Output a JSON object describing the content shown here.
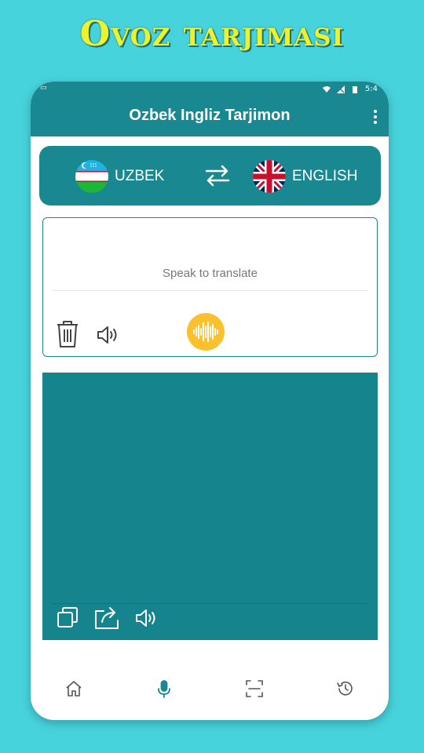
{
  "promo": {
    "title": "Ovoz tarjimasi"
  },
  "status_bar": {
    "time": "5:4"
  },
  "app_bar": {
    "title": "Ozbek Ingliz Tarjimon",
    "menu_icon": "more-vert-icon"
  },
  "languages": {
    "source": {
      "label": "UZBEK",
      "flag_icon": "uzbekistan-flag-icon"
    },
    "target": {
      "label": "ENGLISH",
      "flag_icon": "uk-flag-icon"
    },
    "swap_icon": "swap-icon"
  },
  "input": {
    "placeholder": "Speak to translate"
  },
  "colors": {
    "accent": "#1a8891",
    "background": "#47d3dc",
    "mic": "#fbc02d",
    "promo_text": "#eef22a"
  },
  "bottom_nav": [
    {
      "id": "home",
      "icon": "home-icon"
    },
    {
      "id": "voice",
      "icon": "mic-icon",
      "active": true
    },
    {
      "id": "scan",
      "icon": "scan-icon"
    },
    {
      "id": "history",
      "icon": "history-icon"
    }
  ]
}
